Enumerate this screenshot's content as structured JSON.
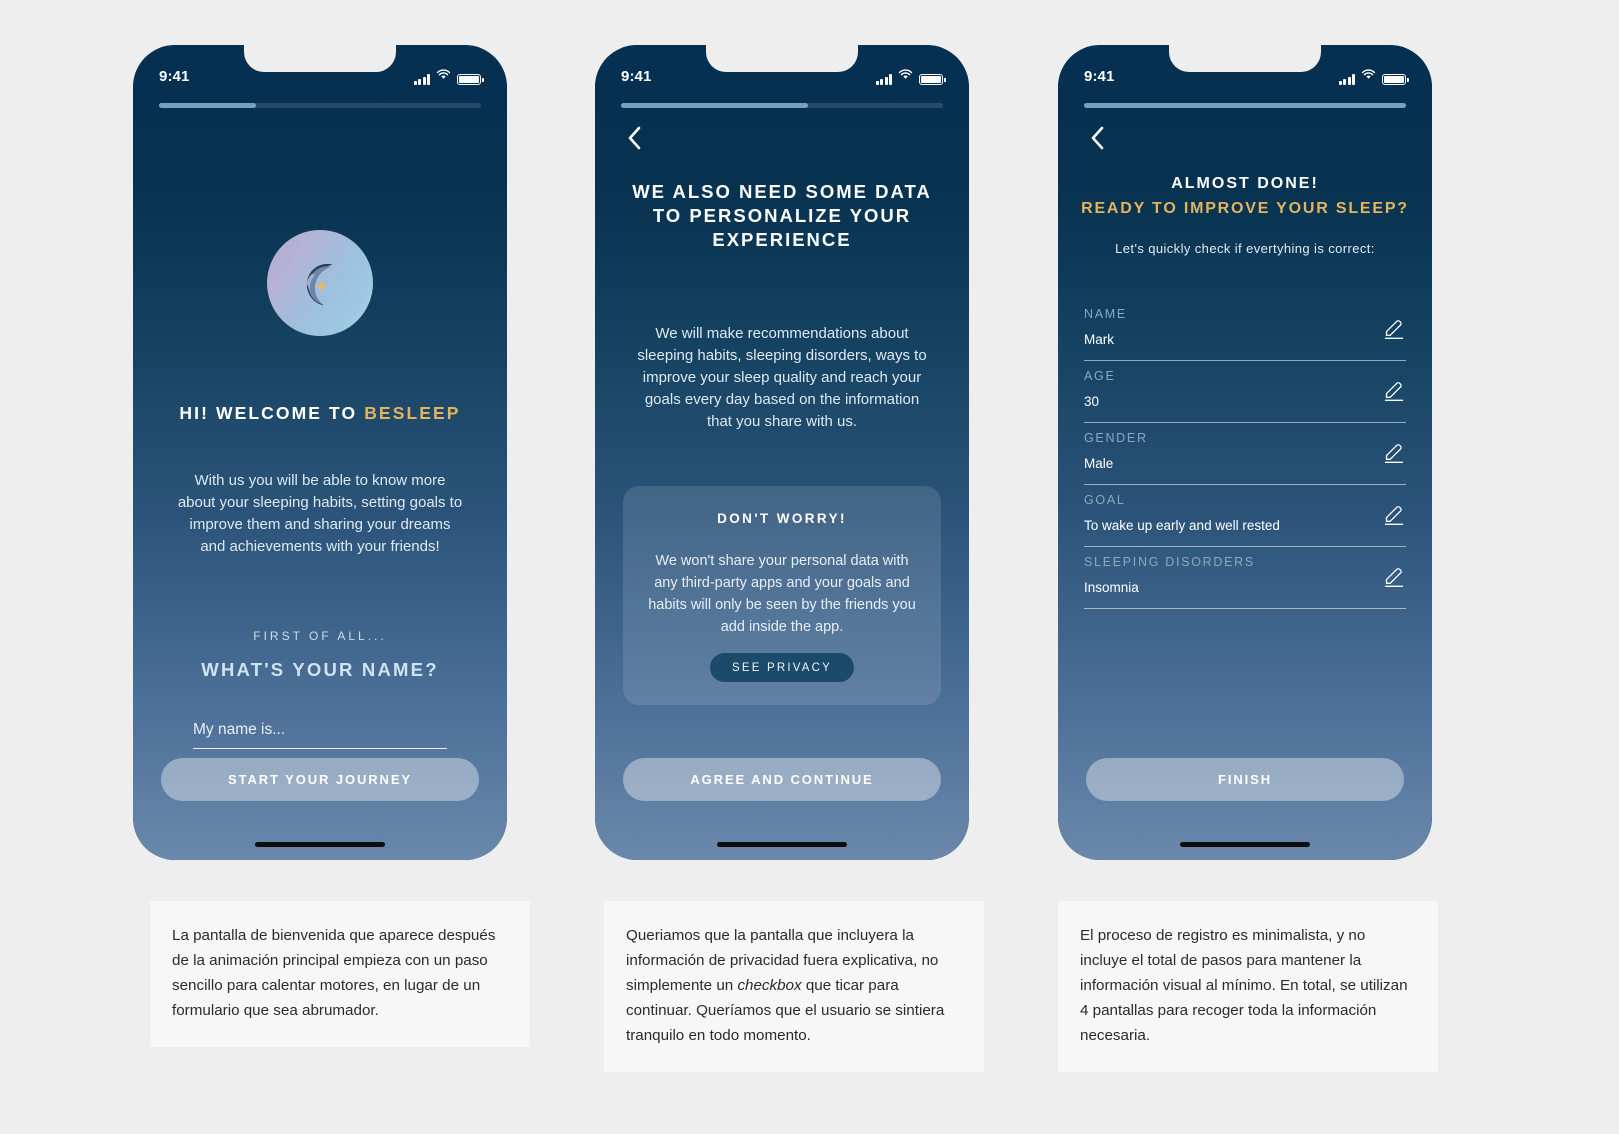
{
  "background_color": "#eeeeee",
  "accent_gold": "#e3b460",
  "screens": [
    {
      "id": "welcome",
      "statusbar": {
        "time": "9:41"
      },
      "progress_percent": 30,
      "has_back": false,
      "logo": "crescent-moon-star-logo",
      "title_prefix": "HI! WELCOME TO ",
      "title_brand": "BESLEEP",
      "body": "With us you will be able to know more about your sleeping habits, setting goals to improve them\nand sharing your dreams and achievements with your friends!",
      "eyebrow": "FIRST OF ALL...",
      "question": "WHAT'S YOUR NAME?",
      "input_placeholder": "My name is...",
      "input_value": "",
      "cta_label": "START YOUR JOURNEY"
    },
    {
      "id": "privacy",
      "statusbar": {
        "time": "9:41"
      },
      "progress_percent": 58,
      "has_back": true,
      "title": "WE ALSO NEED SOME DATA TO PERSONALIZE YOUR EXPERIENCE",
      "body": "We will make recommendations about sleeping habits, sleeping disorders, ways to improve your sleep quality and reach your goals every day based on the information that you share with us.",
      "card": {
        "title": "DON'T WORRY!",
        "body": "We won't share your personal data with any third-party apps and your goals and habits will only be seen by the friends you add inside the app.",
        "button_label": "SEE PRIVACY"
      },
      "cta_label": "AGREE AND CONTINUE"
    },
    {
      "id": "summary",
      "statusbar": {
        "time": "9:41"
      },
      "progress_percent": 100,
      "has_back": true,
      "heading_line1": "ALMOST DONE!",
      "heading_line2": "READY TO IMPROVE YOUR SLEEP?",
      "subheading": "Let's quickly check if evertyhing is correct:",
      "fields": [
        {
          "label": "NAME",
          "value": "Mark",
          "edit_icon": "pencil-icon"
        },
        {
          "label": "AGE",
          "value": "30",
          "edit_icon": "pencil-icon"
        },
        {
          "label": "GENDER",
          "value": "Male",
          "edit_icon": "pencil-icon"
        },
        {
          "label": "GOAL",
          "value": "To wake up early and well rested",
          "edit_icon": "pencil-icon"
        },
        {
          "label": "SLEEPING DISORDERS",
          "value": "Insomnia",
          "edit_icon": "pencil-icon"
        }
      ],
      "cta_label": "FINISH"
    }
  ],
  "captions": [
    {
      "text": "La pantalla de bienvenida que aparece después de la animación principal empieza con un paso sencillo para calentar motores, en lugar de un formulario que sea abrumador."
    },
    {
      "pre": "Queriamos que la pantalla que incluyera la información de privacidad fuera explicativa, no simplemente un ",
      "italic": "checkbox",
      "post": " que ticar para continuar. Queríamos que el usuario se sintiera tranquilo en todo momento."
    },
    {
      "text": "El proceso de registro es minimalista, y no incluye el total de pasos para mantener la información visual al mínimo. En total, se utilizan 4 pantallas para recoger toda la información necesaria."
    }
  ]
}
